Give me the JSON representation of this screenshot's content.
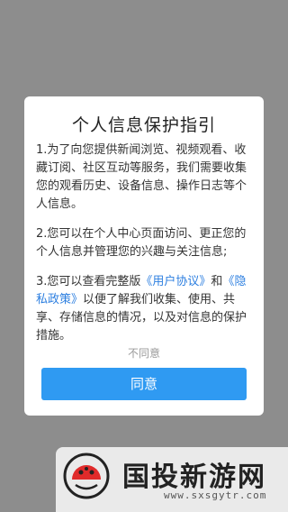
{
  "dialog": {
    "title": "个人信息保护指引",
    "paragraph1": "1.为了向您提供新闻浏览、视频观看、收藏订阅、社区互动等服务，我们需要收集您的观看历史、设备信息、操作日志等个人信息。",
    "paragraph2": "2.您可以在个人中心页面访问、更正您的个人信息并管理您的兴趣与关注信息;",
    "paragraph3_prefix": "3.您可以查看完整版",
    "user_agreement_link": "《用户协议》",
    "and_text": "和",
    "privacy_policy_link": "《隐私政策》",
    "paragraph3_suffix": "以便了解我们收集、使用、共享、存储信息的情况，以及对信息的保护措施。",
    "disagree_label": "不同意",
    "agree_label": "同意"
  },
  "watermark": {
    "brand": "国投新游网",
    "url": "www.sxsgytr.com"
  },
  "colors": {
    "overlay": "#8d8d8d",
    "accent": "#2f9af2",
    "link": "#2d7fe0"
  }
}
